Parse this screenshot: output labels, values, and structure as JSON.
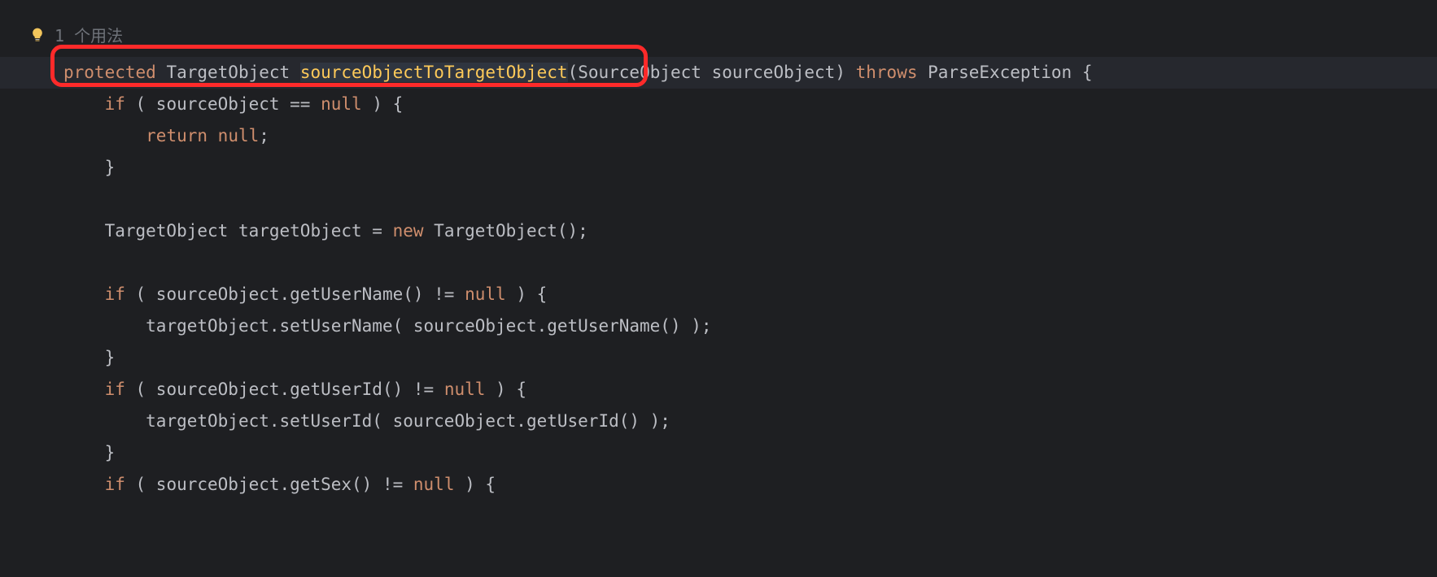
{
  "hint": {
    "usage_label": "1 个用法"
  },
  "code": {
    "l1": {
      "kw_protected": "protected",
      "return_type": "TargetObject",
      "method_name": "sourceObjectToTargetObject",
      "lparen": "(",
      "param_type": "SourceObject",
      "param_name": "sourceObject",
      "rparen": ")",
      "kw_throws": "throws",
      "exception": "ParseException",
      "lbrace": "{"
    },
    "l2": {
      "kw_if": "if",
      "text": " ( sourceObject == ",
      "kw_null": "null",
      "text2": " ) {"
    },
    "l3": {
      "kw_return": "return",
      "kw_null": "null",
      "semi": ";"
    },
    "l4": {
      "rbrace": "}"
    },
    "l5": {
      "blank": ""
    },
    "l6": {
      "type": "TargetObject",
      "var": " targetObject = ",
      "kw_new": "new",
      "ctor": " TargetObject();"
    },
    "l7": {
      "blank": ""
    },
    "l8": {
      "kw_if": "if",
      "text": " ( sourceObject.getUserName() != ",
      "kw_null": "null",
      "text2": " ) {"
    },
    "l9": {
      "text": "targetObject.setUserName( sourceObject.getUserName() );"
    },
    "l10": {
      "rbrace": "}"
    },
    "l11": {
      "kw_if": "if",
      "text": " ( sourceObject.getUserId() != ",
      "kw_null": "null",
      "text2": " ) {"
    },
    "l12": {
      "text": "targetObject.setUserId( sourceObject.getUserId() );"
    },
    "l13": {
      "rbrace": "}"
    },
    "l14": {
      "kw_if": "if",
      "text": " ( sourceObject.getSex() != ",
      "kw_null": "null",
      "text2": " ) {"
    }
  }
}
